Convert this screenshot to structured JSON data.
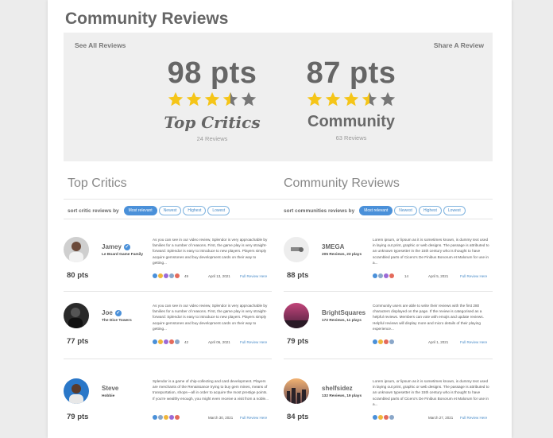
{
  "title": "Community Reviews",
  "summary": {
    "see_all": "See All Reviews",
    "share": "Share A Review",
    "critics": {
      "score": "98 pts",
      "stars": 3.5,
      "label": "Top Critics",
      "count": "24 Reviews"
    },
    "community": {
      "score": "87 pts",
      "stars": 3.5,
      "label": "Community",
      "count": "63 Reviews"
    }
  },
  "colors": {
    "star": "#f5c518",
    "star_empty": "#777777",
    "accent": "#4a90d9"
  },
  "critics": {
    "title": "Top Critics",
    "sort_label": "sort critic reviews by",
    "sort_options": [
      "Most relevant",
      "Newest",
      "Highest",
      "Lowest"
    ],
    "reviews": [
      {
        "name": "Jamey",
        "sub": "Le Board Game Family",
        "pts": "80 pts",
        "text": "As you can see in our video review, Splendor is very approachable by families for a number of reasons. First, the game play is very straight-forward: Splendor is easy to introduce to new players. Players simply acquire gemstones and buy development cards on their way to getting...",
        "count": "49",
        "date": "April 13, 2021",
        "full": "Full Review Here"
      },
      {
        "name": "Joe",
        "sub": "The Dice Towers",
        "pts": "77 pts",
        "text": "As you can see in our video review, Splendor is very approachable by families for a number of reasons. First, the game play is very straight-forward: Splendor is easy to introduce to new players. Players simply acquire gemstones and buy development cards on their way to getting...",
        "count": "42",
        "date": "April 06, 2021",
        "full": "Full Review Here"
      },
      {
        "name": "Steve",
        "sub": "Hobbie",
        "pts": "79 pts",
        "text": "Splendor is a game of chip-collecting and card development. Players are merchants of the Renaissance trying to buy gem mines, means of transportation, shops—all in order to acquire the most prestige points. If you're wealthy enough, you might even receive a visit from a noble...",
        "count": "",
        "date": "March 30, 2021",
        "full": "Full Review Here"
      }
    ]
  },
  "community": {
    "title": "Community Reviews",
    "sort_label": "sort communities reviews by",
    "sort_options": [
      "Most relevant",
      "Newest",
      "Highest",
      "Lowest"
    ],
    "reviews": [
      {
        "name": "3MEGA",
        "sub": "205 Reviews, 23 plays",
        "pts": "88 pts",
        "text": "Lorem ipsum, or lipsum as it is sometimes known, is dummy text used in laying out print, graphic or web designs. The passage is attributed to an unknown typesetter in the 15th century who is thought to have scrambled parts of Cicero's De Finibus Bonorum et Malorum for use in a...",
        "count": "14",
        "date": "April 5, 2021",
        "full": "Full Review Here"
      },
      {
        "name": "BrightSquares",
        "sub": "172 Reviews, 11 plays",
        "pts": "79 pts",
        "text": "Community users are able to write their reviews with the first 280 characters displayed on the page. If the review is categorised as a helpful reviews. Members can vote with emojis and update reviews. Helpful reviews will display more and micro details of their playing experience...",
        "count": "",
        "date": "April 1, 2021",
        "full": "Full Review Here"
      },
      {
        "name": "shelfsidez",
        "sub": "132 Reviews, 19 plays",
        "pts": "84 pts",
        "text": "Lorem ipsum, or lipsum as it is sometimes known, is dummy text used in laying out print, graphic or web designs. The passage is attributed to an unknown typesetter in the 15th century who is thought to have scrambled parts of Cicero's De Finibus Bonorum et Malorum for use in a...",
        "count": "",
        "date": "March 27, 2021",
        "full": "Full Review Here"
      }
    ]
  }
}
